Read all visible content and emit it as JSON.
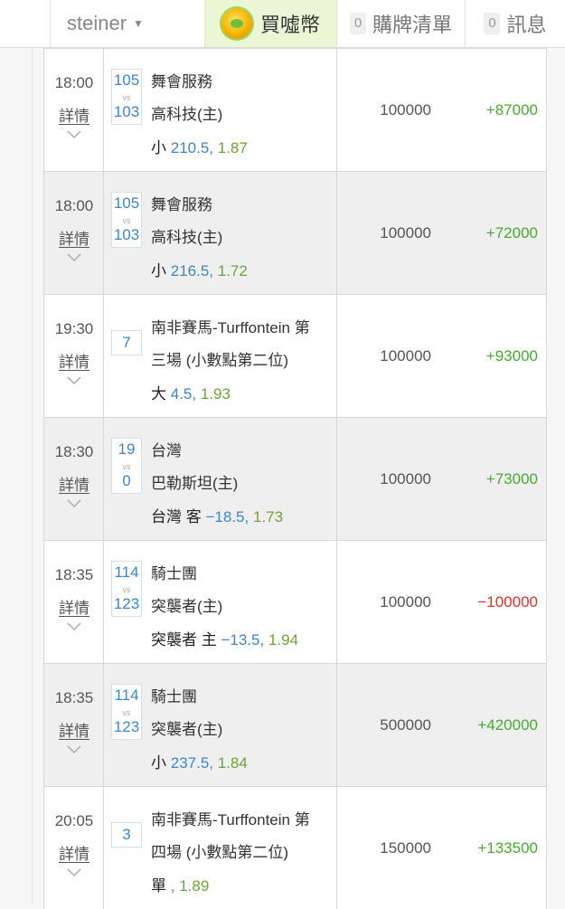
{
  "header": {
    "username": "steiner",
    "buy_coins_label": "買噓幣",
    "cart_count": "0",
    "cart_label": "購牌清單",
    "messages_count": "0",
    "messages_label": "訊息"
  },
  "detail_label": "詳情",
  "rows": [
    {
      "time": "18:00",
      "score1": "105",
      "vs": "vs",
      "score2": "103",
      "team1": "舞會服務",
      "team2": "高科技(主)",
      "sel": "小",
      "line": "210.5,",
      "odds": "1.87",
      "stake": "100000",
      "result": "+87000"
    },
    {
      "time": "18:00",
      "score1": "105",
      "vs": "vs",
      "score2": "103",
      "team1": "舞會服務",
      "team2": "高科技(主)",
      "sel": "小",
      "line": "216.5,",
      "odds": "1.72",
      "stake": "100000",
      "result": "+72000"
    },
    {
      "time": "19:30",
      "single": "7",
      "team1": "南非賽馬-Turffontein 第",
      "team2": "三場 (小數點第二位)",
      "sel": "大",
      "line": "4.5,",
      "odds": "1.93",
      "stake": "100000",
      "result": "+93000"
    },
    {
      "time": "18:30",
      "score1": "19",
      "vs": "vs",
      "score2": "0",
      "team1": "台灣",
      "team2": "巴勒斯坦(主)",
      "sel": "台灣 客",
      "line": "−18.5,",
      "odds": "1.73",
      "stake": "100000",
      "result": "+73000"
    },
    {
      "time": "18:35",
      "score1": "114",
      "vs": "vs",
      "score2": "123",
      "team1": "騎士團",
      "team2": "突襲者(主)",
      "sel": "突襲者 主",
      "line": "−13.5,",
      "odds": "1.94",
      "stake": "100000",
      "result": "−100000"
    },
    {
      "time": "18:35",
      "score1": "114",
      "vs": "vs",
      "score2": "123",
      "team1": "騎士團",
      "team2": "突襲者(主)",
      "sel": "小",
      "line": "237.5,",
      "odds": "1.84",
      "stake": "500000",
      "result": "+420000"
    },
    {
      "time": "20:05",
      "single": "3",
      "team1": "南非賽馬-Turffontein 第",
      "team2": "四場 (小數點第二位)",
      "sel": "單",
      "line": ",",
      "odds": "1.89",
      "stake": "150000",
      "result": "+133500"
    }
  ],
  "colors": {
    "win": "#4aa832",
    "loss": "#e2302b",
    "line": "#3d86c6",
    "odds": "#6aa536",
    "alt_row": "#efefef"
  }
}
